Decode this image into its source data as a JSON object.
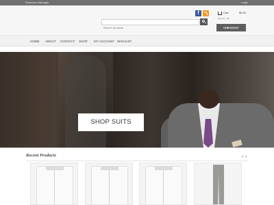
{
  "topbar": {
    "left_text": "Password Manager",
    "login_label": "Login"
  },
  "header": {
    "facebook_glyph": "f",
    "search": {
      "placeholder": "Search products"
    },
    "cart": {
      "label": "Cart",
      "total": "$0.00",
      "items_text": "items(s) - $0"
    },
    "checkout_label": "CHECKOUT"
  },
  "nav": {
    "items": [
      {
        "label": "HOME"
      },
      {
        "label": "ABOUT"
      },
      {
        "label": "CONTACT"
      },
      {
        "label": "SHOP"
      },
      {
        "label": "MY ACCOUNT"
      },
      {
        "label": "WISHLIST"
      }
    ]
  },
  "hero": {
    "cta_label": "SHOP SUITS"
  },
  "recent": {
    "title": "Recent Products",
    "prev_glyph": "‹",
    "next_glyph": "›"
  },
  "icons": {
    "social": [
      "facebook-icon",
      "rss-icon"
    ],
    "search": "search-icon",
    "cart": "cart-icon"
  },
  "colors": {
    "topbar": "#6f6f6f",
    "checkout": "#5e5e5e",
    "facebook": "#3b5998",
    "rss": "#f29a1e",
    "nav_bg": "#f1f1f1"
  }
}
